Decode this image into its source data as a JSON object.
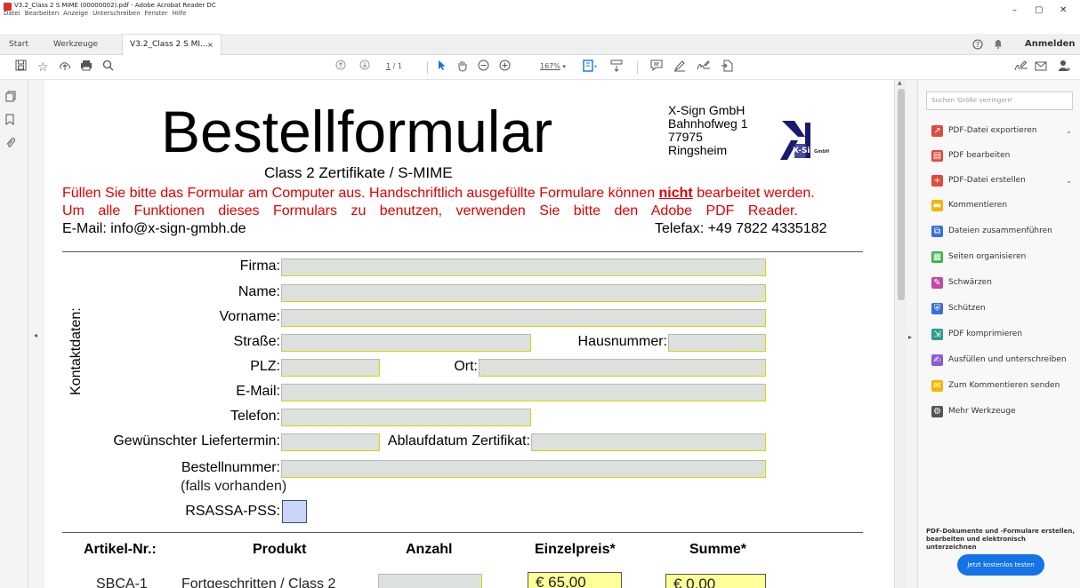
{
  "window": {
    "title": "V3.2_Class 2 S MIME (00000002).pdf - Adobe Acrobat Reader DC",
    "menu": [
      "Datei",
      "Bearbeiten",
      "Anzeige",
      "Unterschreiben",
      "Fenster",
      "Hilfe"
    ],
    "controls": {
      "minimize": "–",
      "maximize": "▢",
      "close": "✕"
    }
  },
  "tabs": {
    "start": "Start",
    "tools": "Werkzeuge",
    "doc": "V3.2_Class 2 S MI...",
    "doc_close": "×",
    "help": "?",
    "bell": "🔔",
    "signin": "Anmelden"
  },
  "toolbar": {
    "page_current": "1",
    "page_total": "/ 1",
    "zoom": "167%"
  },
  "right_panel": {
    "search_placeholder": "Suchen 'Größe verringern'",
    "tools": [
      {
        "label": "PDF-Datei exportieren",
        "color": "#e04a3f",
        "expand": true
      },
      {
        "label": "PDF bearbeiten",
        "color": "#e04a3f",
        "expand": false
      },
      {
        "label": "PDF-Datei erstellen",
        "color": "#e04a3f",
        "expand": true
      },
      {
        "label": "Kommentieren",
        "color": "#f5b400",
        "expand": false
      },
      {
        "label": "Dateien zusammenführen",
        "color": "#3c6fd8",
        "expand": false
      },
      {
        "label": "Seiten organisieren",
        "color": "#3fb24a",
        "expand": false
      },
      {
        "label": "Schwärzen",
        "color": "#c04aa8",
        "expand": false
      },
      {
        "label": "Schützen",
        "color": "#3c6fd8",
        "expand": false
      },
      {
        "label": "PDF komprimieren",
        "color": "#2a9d8f",
        "expand": false
      },
      {
        "label": "Ausfüllen und unterschreiben",
        "color": "#8a5cd8",
        "expand": false
      },
      {
        "label": "Zum Kommentieren senden",
        "color": "#f5b400",
        "expand": false
      },
      {
        "label": "Mehr Werkzeuge",
        "color": "#555555",
        "expand": false
      }
    ],
    "promo_text": "PDF-Dokumente und -Formulare erstellen, bearbeiten und elektronisch unterzeichnen",
    "promo_button": "Jetzt kostenlos testen"
  },
  "document": {
    "title": "Bestellformular",
    "subtitle": "Class 2 Zertifikate / S-MIME",
    "address": [
      "X-Sign  GmbH",
      "Bahnhofweg  1",
      "77975",
      "Ringsheim"
    ],
    "logo_text": "X-Sign",
    "logo_small": "GmbH",
    "notice_1a": "Füllen Sie bitte das Formular am Computer aus. Handschriftlich ausgefüllte Formulare können ",
    "notice_1b": "nicht",
    "notice_1c": " bearbeitet werden.",
    "notice_2": "Um alle Funktionen dieses Formulars zu benutzen, verwenden Sie bitte den Adobe PDF Reader.",
    "email": "E-Mail: info@x-sign-gmbh.de",
    "fax": "Telefax: +49 7822 4335182",
    "section_label": "Kontaktdaten:",
    "fields": {
      "firma": "Firma:",
      "name": "Name:",
      "vorname": "Vorname:",
      "strasse": "Straße:",
      "hausnummer": "Hausnummer:",
      "plz": "PLZ:",
      "ort": "Ort:",
      "email": "E-Mail:",
      "telefon": "Telefon:",
      "liefertermin": "Gewünschter Liefertermin:",
      "ablaufdatum": "Ablaufdatum Zertifikat:",
      "bestellnummer": "Bestellnummer:",
      "falls": "(falls vorhanden)",
      "rsassa": "RSASSA-PSS:"
    },
    "table": {
      "headers": [
        "Artikel-Nr.:",
        "Produkt",
        "Anzahl",
        "Einzelpreis*",
        "Summe*"
      ],
      "rows": [
        {
          "article": "SBCA-1",
          "product": "Fortgeschritten / Class 2",
          "qty": "",
          "unit_price": "€ 65,00",
          "sum": "€ 0,00"
        }
      ]
    }
  }
}
